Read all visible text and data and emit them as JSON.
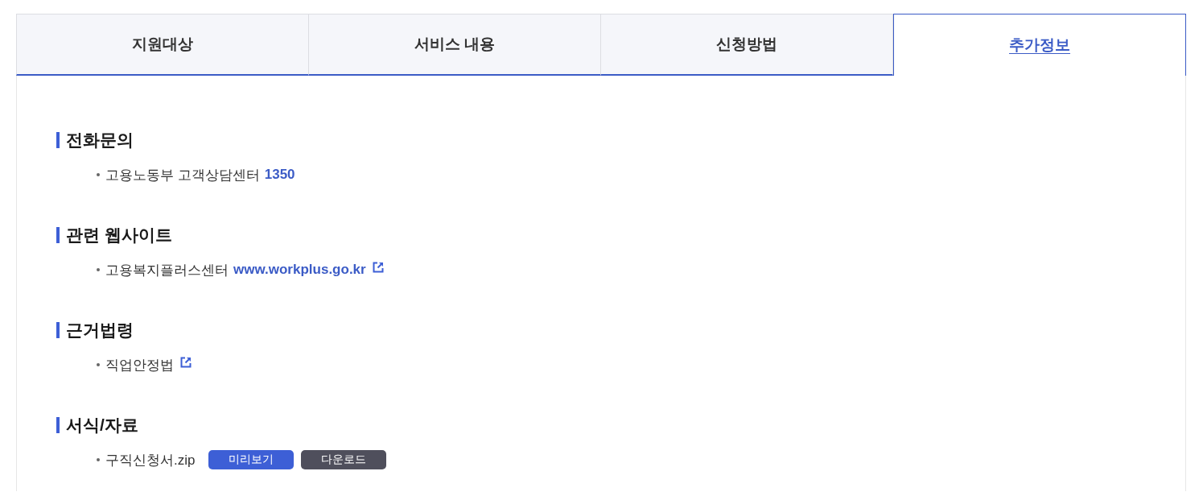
{
  "tabs": [
    {
      "label": "지원대상",
      "selected": false
    },
    {
      "label": "서비스 내용",
      "selected": false
    },
    {
      "label": "신청방법",
      "selected": false
    },
    {
      "label": "추가정보",
      "selected": true
    }
  ],
  "sections": [
    {
      "title": "전화문의",
      "items": [
        {
          "text": "고용노동부 고객상담센터",
          "link": "1350",
          "external": false
        }
      ]
    },
    {
      "title": "관련 웹사이트",
      "items": [
        {
          "text": "고용복지플러스센터",
          "link": "www.workplus.go.kr",
          "external": true
        }
      ]
    },
    {
      "title": "근거법령",
      "items": [
        {
          "text": "직업안정법",
          "external": true
        }
      ]
    },
    {
      "title": "서식/자료",
      "items": [
        {
          "text": "구직신청서.zip",
          "external": false,
          "buttons": [
            {
              "label": "미리보기",
              "kind": "preview"
            },
            {
              "label": "다운로드",
              "kind": "download"
            }
          ]
        }
      ]
    }
  ]
}
